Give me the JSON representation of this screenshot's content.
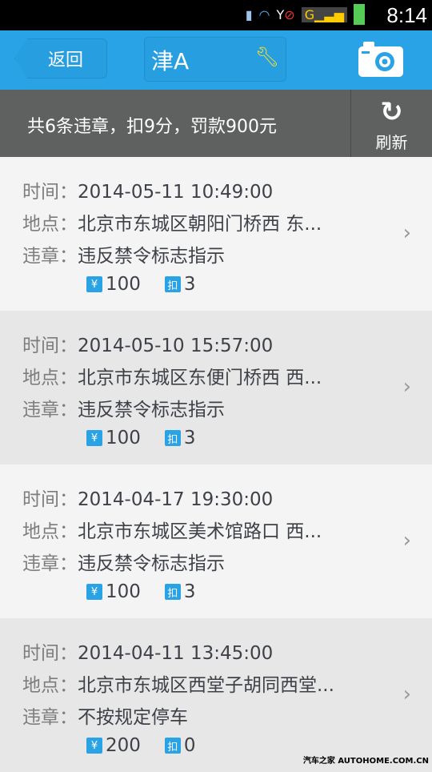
{
  "status_bar": {
    "time": "8:14"
  },
  "watermark": "汽车之家 AUTOHOME.COM.CN",
  "header": {
    "back_label": "返回",
    "plate": "津A",
    "wrench_icon": "wrench-icon",
    "camera_icon": "camera-icon"
  },
  "summary": {
    "text": "共6条违章，扣9分，罚款900元",
    "refresh_label": "刷新"
  },
  "labels": {
    "time": "时间：",
    "place": "地点：",
    "violation": "违章："
  },
  "badge_icons": {
    "fine": "¥",
    "points": "扣"
  },
  "records": [
    {
      "time": "2014-05-11 10:49:00",
      "place": "北京市东城区朝阳门桥西 东...",
      "violation": "违反禁令标志指示",
      "fine": "100",
      "points": "3"
    },
    {
      "time": "2014-05-10 15:57:00",
      "place": "北京市东城区东便门桥西 西...",
      "violation": "违反禁令标志指示",
      "fine": "100",
      "points": "3"
    },
    {
      "time": "2014-04-17 19:30:00",
      "place": "北京市东城区美术馆路口 西...",
      "violation": "违反禁令标志指示",
      "fine": "100",
      "points": "3"
    },
    {
      "time": "2014-04-11 13:45:00",
      "place": "北京市东城区西堂子胡同西堂...",
      "violation": "不按规定停车",
      "fine": "200",
      "points": "0"
    }
  ],
  "colors": {
    "accent": "#2aa3e6",
    "summary_bg": "#5f6060",
    "wrench": "#f3e12a"
  }
}
